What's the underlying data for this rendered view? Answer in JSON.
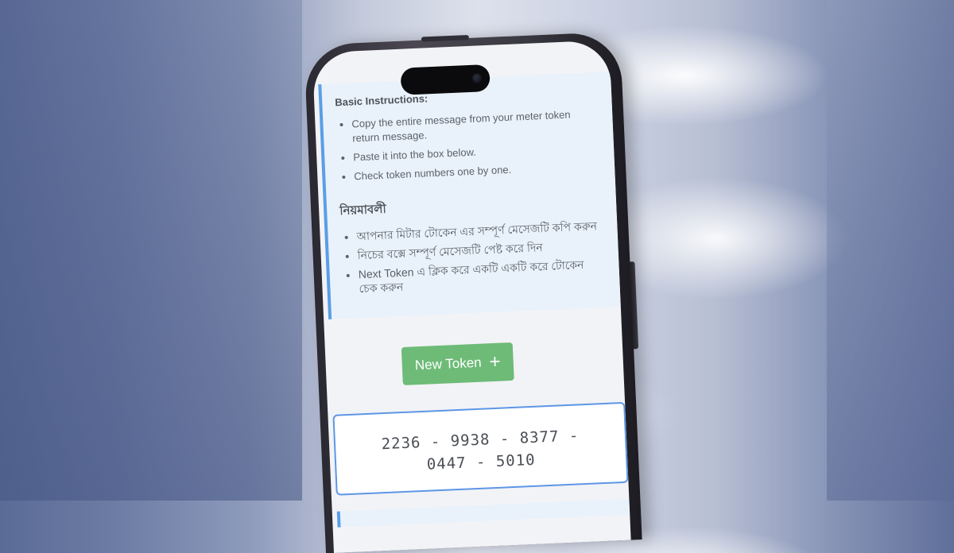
{
  "instructions": {
    "title": "Basic Instructions:",
    "items": [
      "Copy the entire message from your meter token return message.",
      "Paste it into the box below.",
      "Check token numbers one by one."
    ]
  },
  "instructions_bn": {
    "title": "নিয়মাবলী",
    "items": [
      "আপনার মিটার টোকেন এর সম্পূর্ণ মেসেজটি কপি করুন",
      "নিচের বক্সে সম্পূর্ণ মেসেজটি পেষ্ট করে দিন",
      "Next Token এ ক্লিক করে একটি একটি করে টোকেন চেক করুন"
    ]
  },
  "new_token_button": {
    "label": "New Token",
    "icon": "plus-icon"
  },
  "token": {
    "value": "2236 - 9938 - 8377 - 0447 - 5010"
  },
  "colors": {
    "accent_blue": "#5a9ee6",
    "button_green": "#6dbb77",
    "info_bg": "#e9f2fb"
  }
}
